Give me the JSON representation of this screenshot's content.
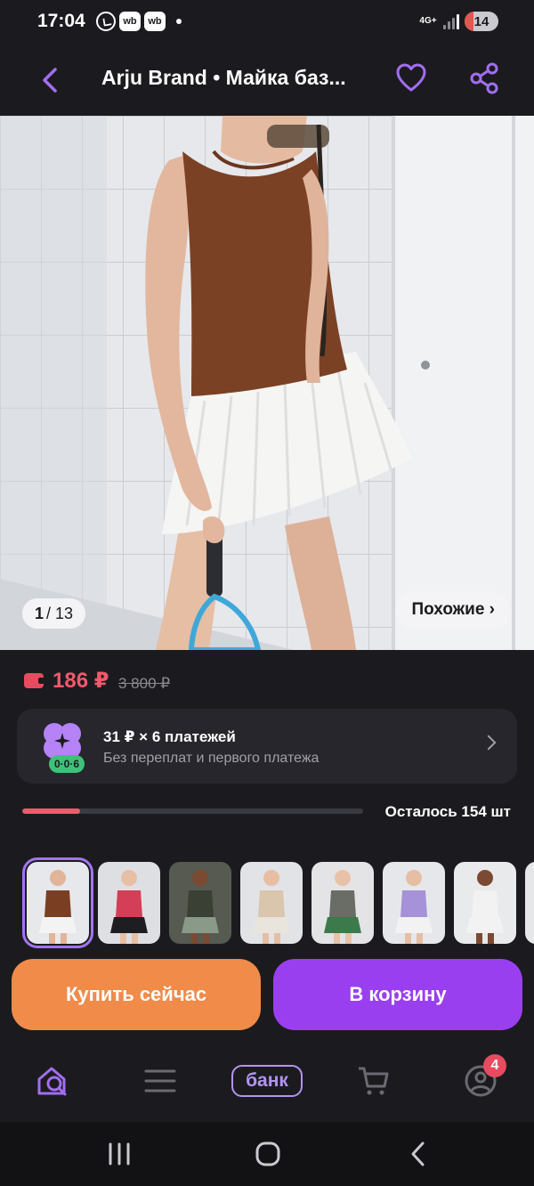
{
  "status": {
    "time": "17:04",
    "app_badges": [
      "wb",
      "wb"
    ],
    "network": "4G+",
    "battery": "14"
  },
  "header": {
    "title": "Arju Brand • Майка баз..."
  },
  "gallery": {
    "current": "1",
    "total": "/ 13",
    "similar_label": "Похожие ›"
  },
  "price": {
    "current": "186 ₽",
    "old": "3 800 ₽"
  },
  "installment": {
    "title": "31 ₽ × 6 платежей",
    "subtitle": "Без переплат и первого платежа",
    "tag": "0·0·6"
  },
  "stock": {
    "text": "Осталось 154 шт",
    "fraction": 0.17
  },
  "thumbnails": [
    {
      "top": "#7a3f22",
      "bottom": "#f3f3f3",
      "bg": "#e7e8ec",
      "skin": "#e2b49a",
      "selected": true
    },
    {
      "top": "#d43e56",
      "bottom": "#1e1e22",
      "bg": "#dedfe3",
      "skin": "#e7bfa5",
      "selected": false
    },
    {
      "top": "#3a4034",
      "bottom": "#8a9a88",
      "bg": "#575a50",
      "skin": "#7a4a32",
      "selected": false
    },
    {
      "top": "#d9c6ad",
      "bottom": "#e9e4dc",
      "bg": "#e2e3e6",
      "skin": "#e7bea2",
      "selected": false
    },
    {
      "top": "#6a6c66",
      "bottom": "#3d7a4b",
      "bg": "#e4e4e7",
      "skin": "#e8c2a8",
      "selected": false
    },
    {
      "top": "#a592d8",
      "bottom": "#f2f2f2",
      "bg": "#e6e7ea",
      "skin": "#e6bea4",
      "selected": false
    },
    {
      "top": "#f2f2f2",
      "bottom": "#f2f2f2",
      "bg": "#e9eaec",
      "skin": "#7a4a32",
      "selected": false
    },
    {
      "top": "#a67c5a",
      "bottom": "#e8e8e8",
      "bg": "#e6e7e9",
      "skin": "#e4bb9f",
      "selected": false
    }
  ],
  "actions": {
    "buy_now": "Купить сейчас",
    "add_to_cart": "В корзину"
  },
  "bottom_nav": {
    "bank_label": "банк",
    "profile_badge": "4"
  },
  "colors": {
    "accent": "#9a3ff0",
    "buy_now": "#f08b4a",
    "price": "#f05a6c",
    "background": "#1b1b1f"
  }
}
